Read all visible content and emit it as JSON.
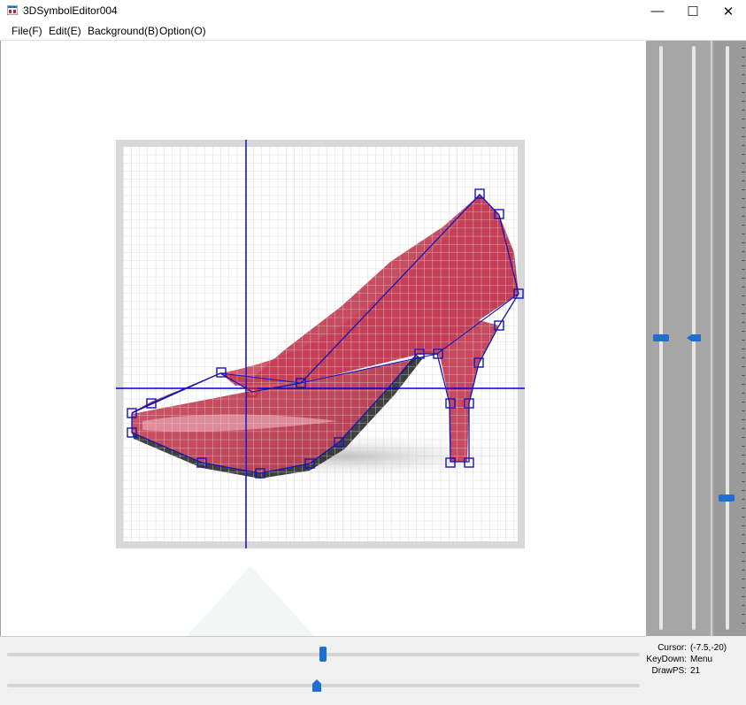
{
  "window": {
    "title": "3DSymbolEditor004",
    "minimize_label": "—",
    "maximize_label": "☐",
    "close_label": "✕"
  },
  "menu": {
    "items": [
      {
        "label": "File(F)"
      },
      {
        "label": "Edit(E)"
      },
      {
        "label": "Background(B)"
      },
      {
        "label": "Option(O)"
      }
    ]
  },
  "status": {
    "cursor_label": "Cursor:",
    "cursor_value": "(-7.5,-20)",
    "keydown_label": "KeyDown:",
    "keydown_value": "Menu",
    "drawps_label": "DrawPS:",
    "drawps_value": "21"
  },
  "colors": {
    "accent": "#1e6fd0",
    "vertex_stroke": "#1515b5",
    "axis_line": "#0000cc",
    "shoe_red": "#c33a50",
    "grid_frame": "#d8d8d8",
    "panel_gray": "#a6a6a6"
  },
  "icons": {
    "app": "app-icon",
    "minimize": "minimize-icon",
    "maximize": "maximize-icon",
    "close": "close-icon"
  }
}
